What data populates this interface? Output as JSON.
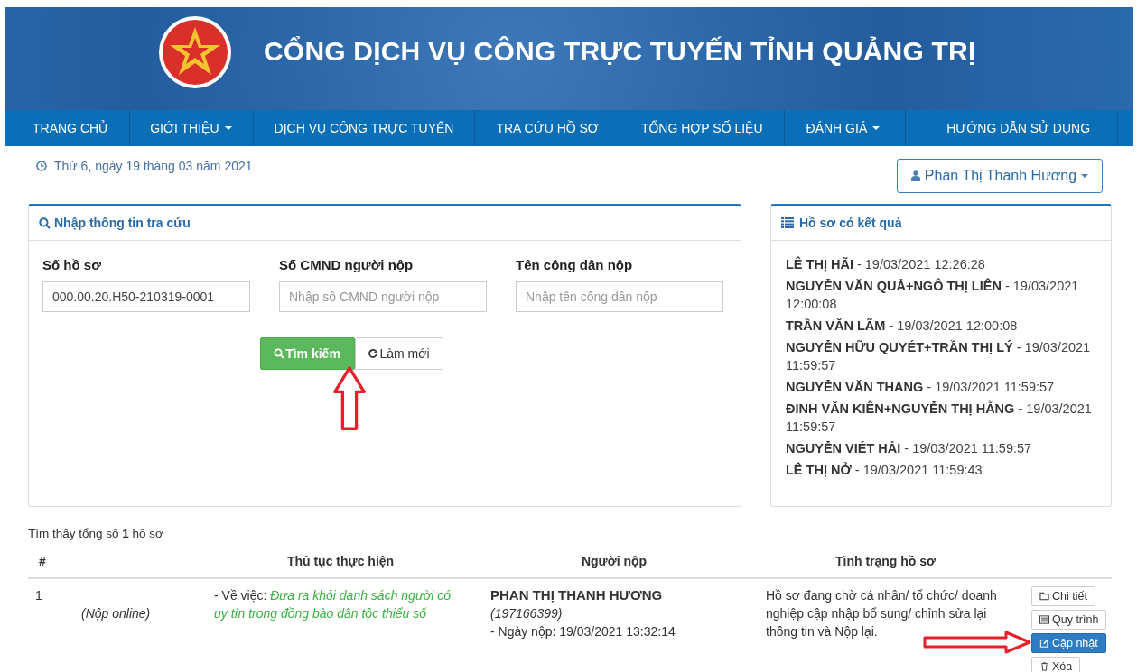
{
  "header": {
    "title": "CỔNG DỊCH VỤ CÔNG TRỰC TUYẾN TỈNH QUẢNG TRỊ"
  },
  "nav": [
    {
      "label": "TRANG CHỦ",
      "dropdown": false
    },
    {
      "label": "GIỚI THIỆU",
      "dropdown": true
    },
    {
      "label": "DỊCH VỤ CÔNG TRỰC TUYẾN",
      "dropdown": false
    },
    {
      "label": "TRA CỨU HỒ SƠ",
      "dropdown": false
    },
    {
      "label": "TỔNG HỢP SỐ LIỆU",
      "dropdown": false
    },
    {
      "label": "ĐÁNH GIÁ",
      "dropdown": true
    },
    {
      "label": "HƯỚNG DẪN SỬ DỤNG",
      "dropdown": false
    }
  ],
  "date": "Thứ 6, ngày 19 tháng 03 năm 2021",
  "user": {
    "name": "Phan Thị Thanh Hương"
  },
  "search_panel": {
    "title": "Nhập thông tin tra cứu",
    "fields": [
      {
        "label": "Số hồ sơ",
        "value": "000.00.20.H50-210319-0001"
      },
      {
        "label": "Số CMND người nộp",
        "placeholder": "Nhập sô CMND người nộp"
      },
      {
        "label": "Tên công dân nộp",
        "placeholder": "Nhập tên công dân nộp"
      }
    ],
    "buttons": [
      {
        "label": "Tìm kiếm",
        "kind": "search"
      },
      {
        "label": "Làm mới",
        "kind": "reset"
      }
    ]
  },
  "results_panel": {
    "title": "Hồ sơ có kết quả",
    "items": [
      {
        "name": "LÊ THỊ HÃI",
        "time": "- 19/03/2021 12:26:28"
      },
      {
        "name": "NGUYỄN VĂN QUẢ+NGÔ THỊ LIÊN",
        "time": "- 19/03/2021 12:00:08"
      },
      {
        "name": "TRẦN VĂN LÃM",
        "time": "- 19/03/2021 12:00:08"
      },
      {
        "name": "NGUYỄN HỮU QUYÉT+TRẦN THỊ LÝ",
        "time": "- 19/03/2021 11:59:57"
      },
      {
        "name": "NGUYỄN VĂN THANG",
        "time": "- 19/03/2021 11:59:57"
      },
      {
        "name": "ĐINH VĂN KIÊN+NGUYỄN THỊ HẰNG",
        "time": "- 19/03/2021 11:59:57"
      },
      {
        "name": "NGUYỄN VIÉT HẢI",
        "time": "- 19/03/2021 11:59:57"
      },
      {
        "name": "LÊ THỊ NỞ",
        "time": "- 19/03/2021 11:59:43"
      }
    ]
  },
  "summary": "Tìm thấy tổng số **1** hồ sơ",
  "table": {
    "columns": [
      "#",
      "Thủ tục thực hiện",
      "Người nộp",
      "Tình trạng hồ sơ"
    ],
    "rows": [
      {
        "index": "1",
        "channel": "(Nộp online)",
        "procedure_prefix": "- Về việc:",
        "procedure": "Đưa ra khỏi danh sách người có uy tín trong đồng bào dân tộc thiểu số",
        "applicant": "PHAN THỊ THANH HƯƠNG",
        "applicant_id": "(197166399)",
        "submitted": "- Ngày nộp: 19/03/2021 13:32:14",
        "status": "Hồ sơ đang chờ cá nhân/ tổ chức/ doanh nghiệp cập nhập bổ sung/ chỉnh sửa lại thông tin và Nộp lại.",
        "actions": [
          {
            "label": "Chi tiết",
            "kind": "detail"
          },
          {
            "label": "Quy trình",
            "kind": "process"
          },
          {
            "label": "Cập nhật",
            "kind": "update"
          },
          {
            "label": "Xóa",
            "kind": "delete"
          }
        ]
      }
    ]
  }
}
